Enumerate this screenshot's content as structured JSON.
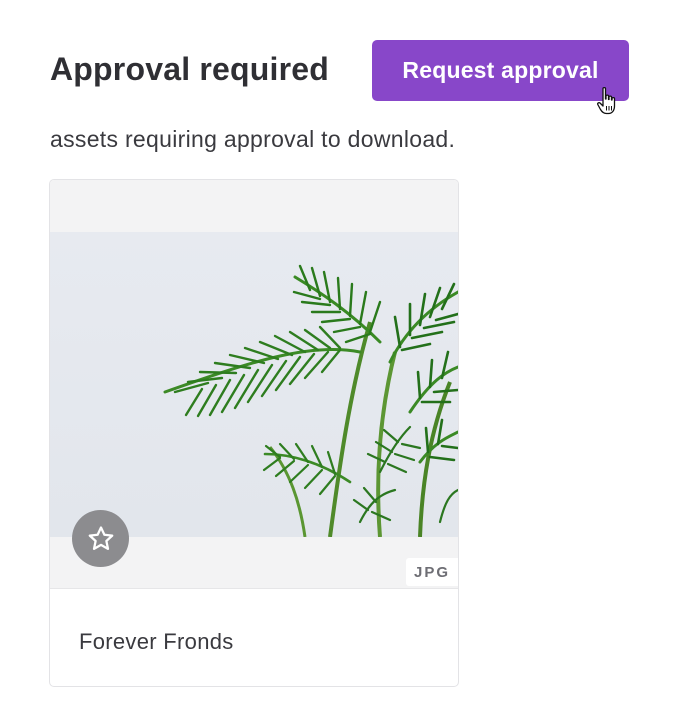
{
  "header": {
    "title": "Approval required",
    "request_button_label": "Request approval",
    "subtitle": "assets requiring approval to download."
  },
  "colors": {
    "accent": "#8847c9",
    "favorite_button": "#8c8c8f"
  },
  "assets": [
    {
      "name": "Forever Fronds",
      "file_type": "JPG",
      "favorited": false,
      "icon": "star-outline-icon"
    }
  ],
  "cursor": "hand-pointer-icon"
}
